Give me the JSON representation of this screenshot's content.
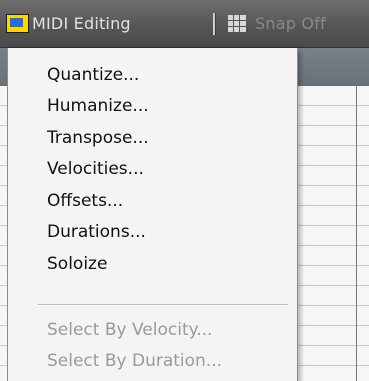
{
  "toolbar": {
    "midi_editing_label": "MIDI Editing",
    "snap_label": "Snap Off"
  },
  "menu": {
    "items": [
      {
        "label": "Quantize...",
        "enabled": true
      },
      {
        "label": "Humanize...",
        "enabled": true
      },
      {
        "label": "Transpose...",
        "enabled": true
      },
      {
        "label": "Velocities...",
        "enabled": true
      },
      {
        "label": "Offsets...",
        "enabled": true
      },
      {
        "label": "Durations...",
        "enabled": true
      },
      {
        "label": "Soloize",
        "enabled": true
      }
    ],
    "disabled_items": [
      {
        "label": "Select By Velocity...",
        "enabled": false
      },
      {
        "label": "Select By Duration...",
        "enabled": false
      }
    ]
  },
  "icons": {
    "midi": "midi-editing-icon",
    "snap": "grid-snap-icon"
  }
}
